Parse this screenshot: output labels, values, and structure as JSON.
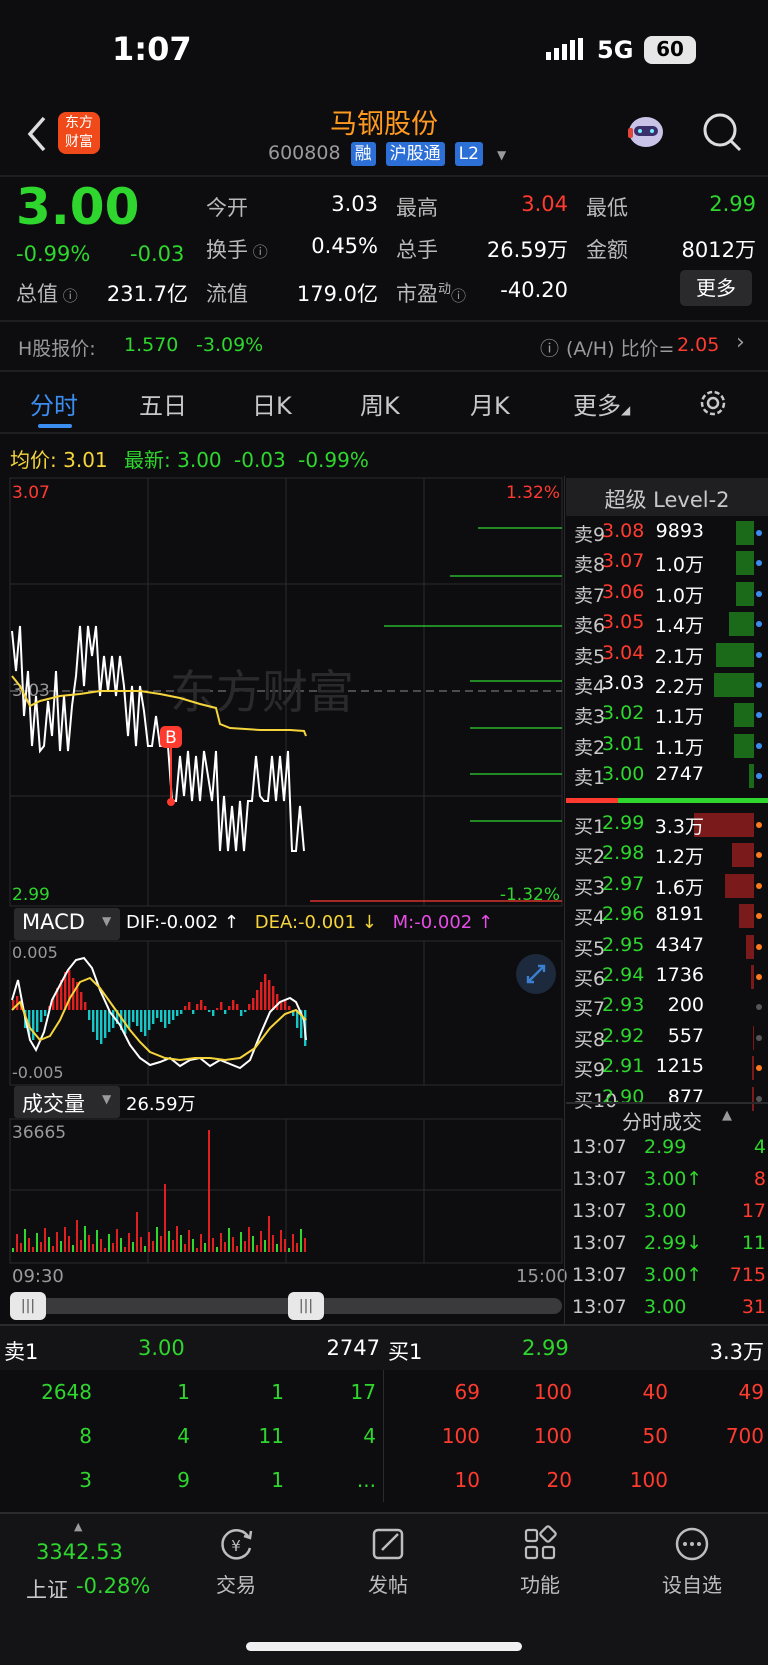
{
  "status_bar": {
    "time": "1:07",
    "network": "5G",
    "battery": "60"
  },
  "header": {
    "app_logo_top": "东方",
    "app_logo_bottom": "财富",
    "stock_name": "马钢股份",
    "stock_code": "600808",
    "badges": [
      "融",
      "沪股通",
      "L2"
    ]
  },
  "quote": {
    "price": "3.00",
    "change_pct": "-0.99%",
    "change": "-0.03",
    "fields": {
      "open_label": "今开",
      "open": "3.03",
      "high_label": "最高",
      "high": "3.04",
      "low_label": "最低",
      "low": "2.99",
      "turnover_label": "换手",
      "turnover": "0.45%",
      "volume_label": "总手",
      "volume": "26.59万",
      "amount_label": "金额",
      "amount": "8012万",
      "mcap_label": "总值",
      "mcap": "231.7亿",
      "float_label": "流值",
      "float": "179.0亿",
      "pe_label": "市盈",
      "pe_sup": "动",
      "pe": "-40.20"
    },
    "more_button": "更多"
  },
  "hshare": {
    "label": "H股报价:",
    "price": "1.570",
    "pct": "-3.09%",
    "ratio_label": "(A/H) 比价=",
    "ratio": "2.05"
  },
  "tabs": [
    "分时",
    "五日",
    "日K",
    "周K",
    "月K",
    "更多"
  ],
  "intraday": {
    "avg_label": "均价:",
    "avg": "3.01",
    "latest_label": "最新:",
    "latest": "3.00",
    "latest_change": "-0.03",
    "latest_pct": "-0.99%",
    "y_top": "3.07",
    "y_mid": "3.03",
    "y_bottom": "2.99",
    "pct_top": "1.32%",
    "pct_bottom": "-1.32%",
    "watermark": "东方财富",
    "marker": "B"
  },
  "macd": {
    "selector": "MACD",
    "dif": "DIF:-0.002 ↑",
    "dea": "DEA:-0.001 ↓",
    "m": "M:-0.002 ↑",
    "y_top": "0.005",
    "y_bottom": "-0.005"
  },
  "volume": {
    "selector": "成交量",
    "total": "26.59万",
    "y_top": "36665",
    "time_start": "09:30",
    "time_end": "15:00"
  },
  "level2": {
    "title": "超级 Level-2",
    "asks": [
      {
        "label": "卖9",
        "price": "3.08",
        "vol": "9893"
      },
      {
        "label": "卖8",
        "price": "3.07",
        "vol": "1.0万"
      },
      {
        "label": "卖7",
        "price": "3.06",
        "vol": "1.0万"
      },
      {
        "label": "卖6",
        "price": "3.05",
        "vol": "1.4万"
      },
      {
        "label": "卖5",
        "price": "3.04",
        "vol": "2.1万"
      },
      {
        "label": "卖4",
        "price": "3.03",
        "vol": "2.2万"
      },
      {
        "label": "卖3",
        "price": "3.02",
        "vol": "1.1万"
      },
      {
        "label": "卖2",
        "price": "3.01",
        "vol": "1.1万"
      },
      {
        "label": "卖1",
        "price": "3.00",
        "vol": "2747"
      }
    ],
    "bids": [
      {
        "label": "买1",
        "price": "2.99",
        "vol": "3.3万"
      },
      {
        "label": "买2",
        "price": "2.98",
        "vol": "1.2万"
      },
      {
        "label": "买3",
        "price": "2.97",
        "vol": "1.6万"
      },
      {
        "label": "买4",
        "price": "2.96",
        "vol": "8191"
      },
      {
        "label": "买5",
        "price": "2.95",
        "vol": "4347"
      },
      {
        "label": "买6",
        "price": "2.94",
        "vol": "1736"
      },
      {
        "label": "买7",
        "price": "2.93",
        "vol": "200"
      },
      {
        "label": "买8",
        "price": "2.92",
        "vol": "557"
      },
      {
        "label": "买9",
        "price": "2.91",
        "vol": "1215"
      },
      {
        "label": "买10",
        "price": "2.90",
        "vol": "877"
      }
    ]
  },
  "trades": {
    "title": "分时成交",
    "rows": [
      {
        "time": "13:07",
        "price": "2.99",
        "vol": "4"
      },
      {
        "time": "13:07",
        "price": "3.00↑",
        "vol": "8"
      },
      {
        "time": "13:07",
        "price": "3.00",
        "vol": "17"
      },
      {
        "time": "13:07",
        "price": "2.99↓",
        "vol": "11"
      },
      {
        "time": "13:07",
        "price": "3.00↑",
        "vol": "715"
      },
      {
        "time": "13:07",
        "price": "3.00",
        "vol": "31"
      }
    ]
  },
  "queue": {
    "sell_label": "卖1",
    "sell_price": "3.00",
    "sell_total": "2747",
    "buy_label": "买1",
    "buy_price": "2.99",
    "buy_total": "3.3万",
    "sell_rows": [
      [
        "2648",
        "1",
        "1",
        "17"
      ],
      [
        "8",
        "4",
        "11",
        "4"
      ],
      [
        "3",
        "9",
        "1",
        "..."
      ]
    ],
    "buy_rows": [
      [
        "69",
        "100",
        "40",
        "49"
      ],
      [
        "100",
        "100",
        "50",
        "700"
      ],
      [
        "10",
        "20",
        "100",
        ""
      ]
    ]
  },
  "bottom_nav": {
    "index_value": "3342.53",
    "index_name": "上证",
    "index_pct": "-0.28%",
    "items": [
      "交易",
      "发帖",
      "功能",
      "设自选"
    ]
  }
}
